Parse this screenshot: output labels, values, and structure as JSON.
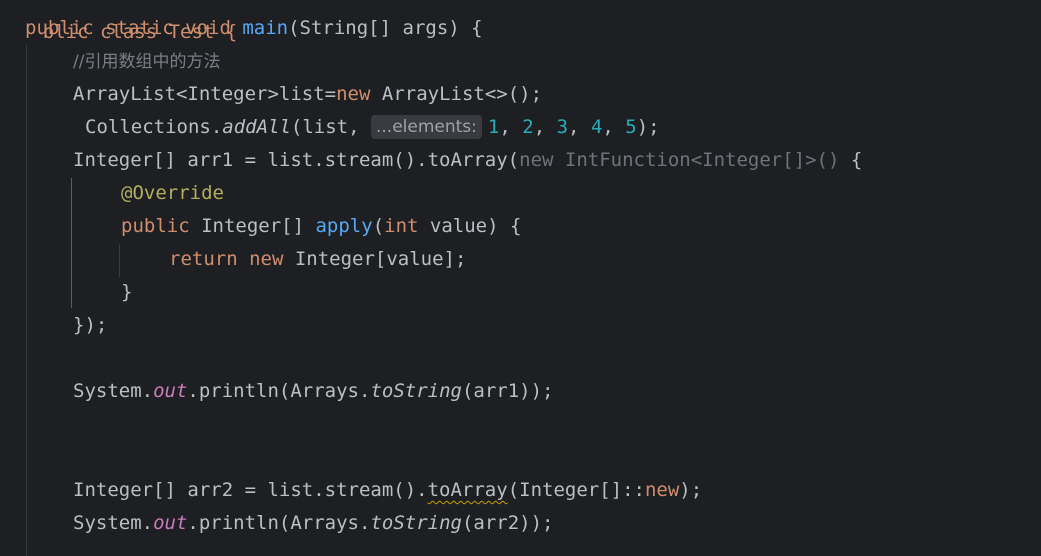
{
  "editor": {
    "language": "java",
    "lines": {
      "top": {
        "text": "blic class Test {"
      },
      "main_signature": {
        "kw": "public static void ",
        "method": "main",
        "rest": "(String[] args) {"
      },
      "comment": {
        "text": "//引用数组中的方法"
      },
      "list_decl": {
        "a": "ArrayList<Integer>list=",
        "kw": "new",
        "b": " ArrayList<>();"
      },
      "add_all": {
        "a": "Collections.",
        "method": "addAll",
        "b": "(list, ",
        "hint": "...elements:",
        "n1": "1",
        "n2": "2",
        "n3": "3",
        "n4": "4",
        "n5": "5",
        "sep": ", ",
        "end": ");"
      },
      "arr1_decl": {
        "a": "Integer[] arr1 = list.stream().toArray(",
        "dim": "new IntFunction<Integer[]>()",
        "b": " {"
      },
      "override": {
        "text": "@Override"
      },
      "apply_sig": {
        "kw": "public",
        "a": " Integer[] ",
        "method": "apply",
        "b": "(",
        "kw2": "int",
        "c": " value) {"
      },
      "return_stmt": {
        "kw": "return new",
        "a": " Integer[value];"
      },
      "close_brace": {
        "text": "}"
      },
      "close_call": {
        "text": "});"
      },
      "print1": {
        "a": "System.",
        "field": "out",
        "b": ".println(Arrays.",
        "method": "toString",
        "c": "(arr1));"
      },
      "arr2_decl": {
        "a": "Integer[] arr2 = list.stream().",
        "warn": "toArray",
        "b": "(Integer[]::",
        "kw": "new",
        "c": ");"
      },
      "print2": {
        "a": "System.",
        "field": "out",
        "b": ".println(Arrays.",
        "method": "toString",
        "c": "(arr2));"
      }
    }
  }
}
